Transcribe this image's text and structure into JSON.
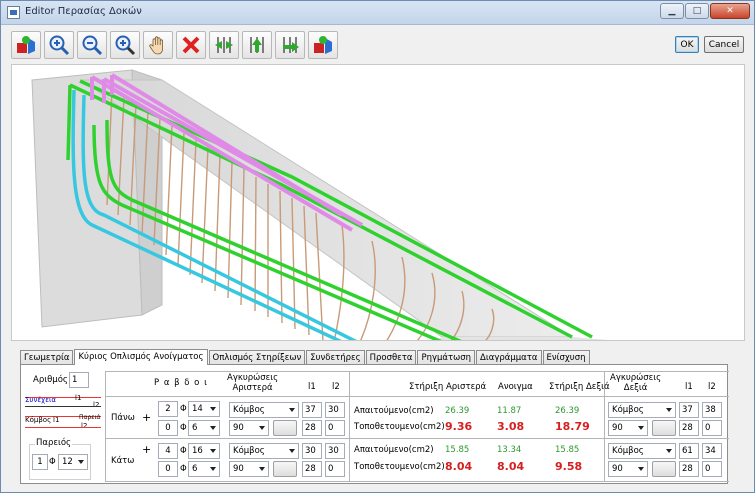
{
  "window": {
    "title": "Editor Περασίας Δοκών"
  },
  "toolbar": {
    "ok_label": "OK",
    "cancel_label": "Cancel"
  },
  "tabs": [
    {
      "label": "Γεωμετρία"
    },
    {
      "label": "Κύριος Οπλισμός Ανοίγματος"
    },
    {
      "label": "Οπλισμός Στηρίξεων"
    },
    {
      "label": "Συνδετήρες"
    },
    {
      "label": "Προσθετα"
    },
    {
      "label": "Ρηγμάτωση"
    },
    {
      "label": "Διαγράμματα"
    },
    {
      "label": "Ενίσχυση"
    }
  ],
  "left": {
    "arithmos_label": "Αριθμός",
    "arithmos_value": "1",
    "synexeia_label": "Συνέχεια",
    "komvos_label": "Κόμβος",
    "pareia_label": "Παρειά",
    "l1": "l1",
    "l2": "l2",
    "pareios_label": "Παρειός",
    "pareios_count": "1",
    "phi": "Φ",
    "pareios_dia": "12"
  },
  "rebars": {
    "header": "Ρ α β δ ο ι",
    "anch_left_header": "Αγκυρώσεις\nΑριστερά",
    "l1": "l1",
    "l2": "l2",
    "top_label": "Πάνω",
    "bottom_label": "Κάτω",
    "plus": "+",
    "phi": "Φ",
    "top": {
      "n1": "2",
      "d1": "14",
      "n2": "0",
      "d2": "6",
      "anch1": "Κόμβος",
      "anch2": "90",
      "l1a": "37",
      "l2a": "30",
      "l1b": "28",
      "l2b": "0"
    },
    "bottom": {
      "n1": "4",
      "d1": "16",
      "n2": "0",
      "d2": "6",
      "anch1": "Κόμβος",
      "anch2": "90",
      "l1a": "30",
      "l2a": "30",
      "l1b": "28",
      "l2b": "0"
    }
  },
  "results": {
    "col_left": "Στήριξη Αριστερά",
    "col_mid": "Ανοιγμα",
    "col_right": "Στήριξη Δεξιά",
    "req_label": "Απαιτούμενο(cm2)",
    "placed_label": "Τοποθετουμενο(cm2)",
    "top": {
      "req_left": "26.39",
      "req_mid": "11.87",
      "req_right": "26.39",
      "pl_left": "9.36",
      "pl_mid": "3.08",
      "pl_right": "18.79"
    },
    "bottom": {
      "req_left": "15.85",
      "req_mid": "13.34",
      "req_right": "15.85",
      "pl_left": "8.04",
      "pl_mid": "8.04",
      "pl_right": "9.58"
    }
  },
  "right": {
    "anch_right_header": "Αγκυρώσεις\nΔεξιά",
    "l1": "l1",
    "l2": "l2",
    "top": {
      "anch1": "Κόμβος",
      "anch2": "90",
      "l1a": "37",
      "l2a": "38",
      "l1b": "28",
      "l2b": "0"
    },
    "bottom": {
      "anch1": "Κόμβος",
      "anch2": "90",
      "l1a": "61",
      "l2a": "34",
      "l1b": "28",
      "l2b": "0"
    }
  },
  "colors": {
    "green_bar": "#2fd12f",
    "cyan_bar": "#36c8e0",
    "pink_bar": "#e08ae8",
    "stirrup": "#c89a78",
    "red_value": "#d62020",
    "green_value": "#2e9a2e"
  }
}
